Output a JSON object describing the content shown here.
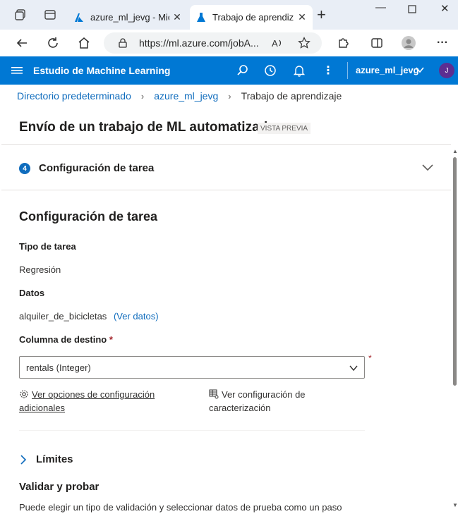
{
  "browser": {
    "tabs": [
      {
        "title": "azure_ml_jevg - Mic",
        "active": false
      },
      {
        "title": "Trabajo de aprendiz",
        "active": true
      }
    ],
    "url": "https://ml.azure.com/jobA..."
  },
  "header": {
    "brand": "Estudio de Machine Learning",
    "workspace": "azure_ml_jevg",
    "avatar_initial": "J"
  },
  "breadcrumb": {
    "items": [
      "Directorio predeterminado",
      "azure_ml_jevg"
    ],
    "current": "Trabajo de aprendizaje"
  },
  "page": {
    "title": "Envío de un trabajo de ML automatizado",
    "badge": "VISTA PREVIA"
  },
  "step": {
    "number": "4",
    "label": "Configuración de tarea"
  },
  "section": {
    "title": "Configuración de tarea",
    "task_type_label": "Tipo de tarea",
    "task_type_value": "Regresión",
    "data_label": "Datos",
    "data_value": "alquiler_de_bicicletas",
    "data_link": "(Ver datos)",
    "target_label": "Columna de destino",
    "required_mark": "*",
    "target_value": "rentals (Integer)",
    "extra_options_link": "Ver opciones de configuración adicionales",
    "featurization_link": "Ver configuración de caracterización",
    "limits_label": "Límites",
    "validate_title": "Validar y probar",
    "validate_desc": "Puede elegir un tipo de validación y seleccionar datos de prueba como un paso"
  }
}
